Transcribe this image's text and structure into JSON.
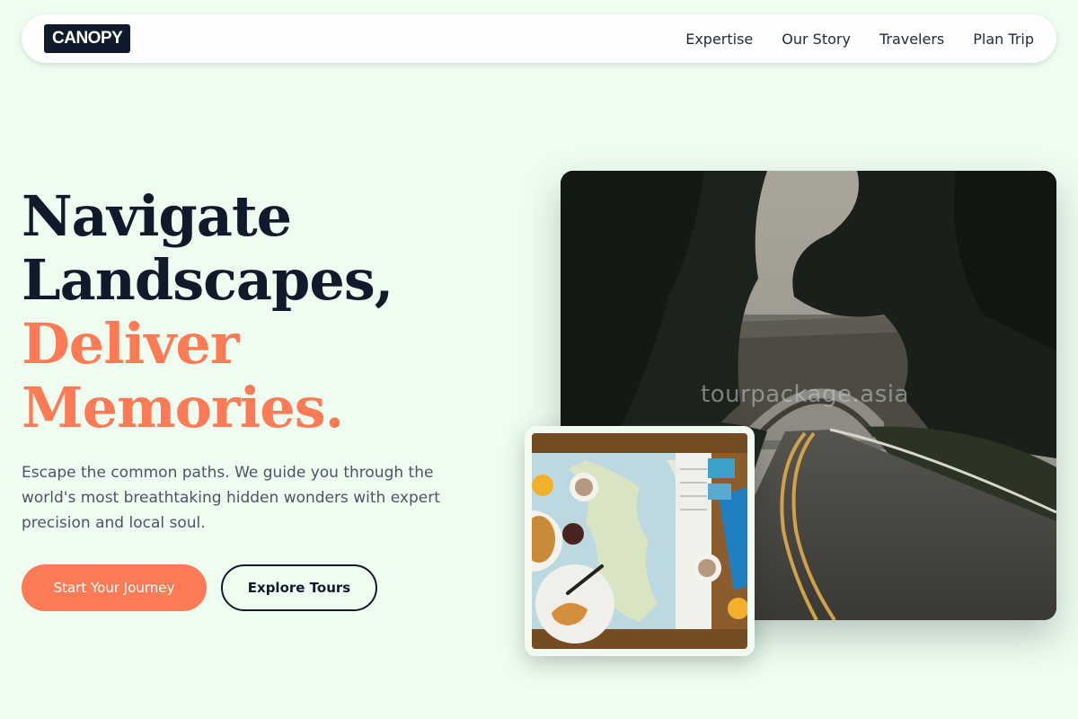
{
  "nav": {
    "logo": "CANOPY",
    "links": [
      "Expertise",
      "Our Story",
      "Travelers",
      "Plan Trip"
    ]
  },
  "hero": {
    "headline": [
      "Navigate",
      "Landscapes,",
      "Deliver",
      "Memories."
    ],
    "subtext": "Escape the common paths. We guide you through the world's most breathtaking hidden wonders with expert precision and local soul.",
    "primary_button": "Start Your Journey",
    "secondary_button": "Explore Tours"
  },
  "media": {
    "main_image": "forest-road-stone-bridge-photo",
    "inset_image": "travel-map-breakfast-table-photo",
    "watermark": "tourpackage.asia"
  },
  "colors": {
    "background": "#effdf1",
    "dark": "#0f1a2a",
    "accent": "#fa7b55"
  }
}
